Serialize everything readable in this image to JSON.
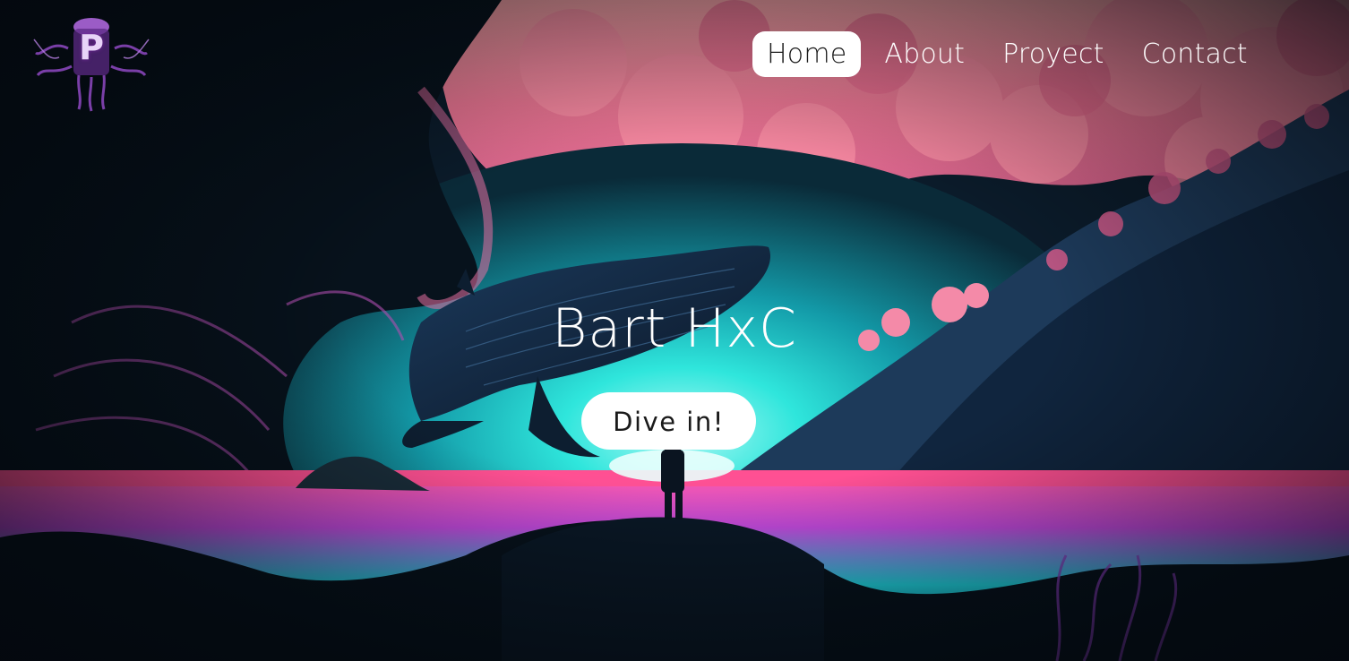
{
  "logo": {
    "letter": "P",
    "icon": "jellyfish-logo-icon"
  },
  "nav": {
    "items": [
      {
        "label": "Home",
        "active": true
      },
      {
        "label": "About",
        "active": false
      },
      {
        "label": "Proyect",
        "active": false
      },
      {
        "label": "Contact",
        "active": false
      }
    ]
  },
  "hero": {
    "title": "Bart HxC",
    "button_label": "Dive in!",
    "image": "underwater-whale-scene"
  },
  "colors": {
    "accent_pink": "#f06a8c",
    "accent_cyan": "#2fe6dc",
    "deep_navy": "#08131c",
    "button_bg": "#ffffff"
  }
}
